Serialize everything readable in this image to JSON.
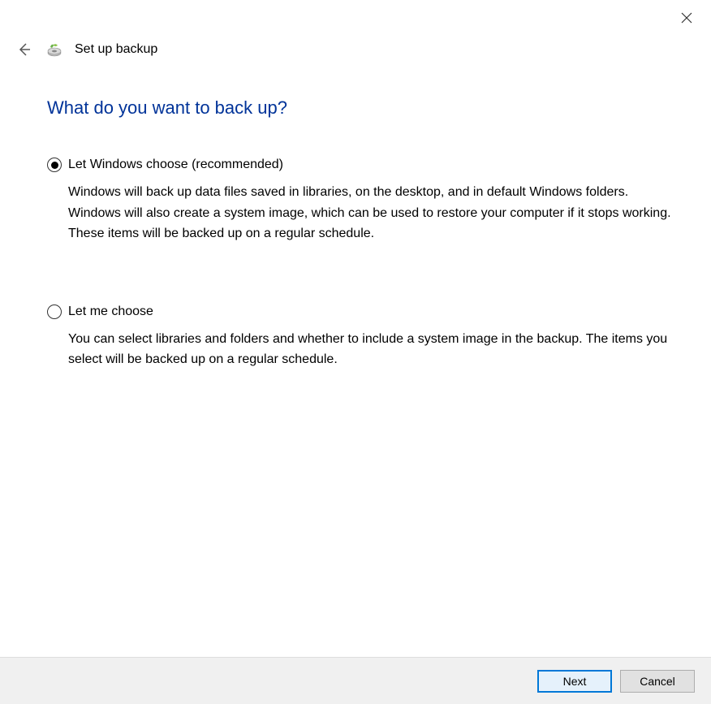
{
  "header": {
    "wizard_title": "Set up backup"
  },
  "main": {
    "question": "What do you want to back up?",
    "options": [
      {
        "label": "Let Windows choose (recommended)",
        "description": "Windows will back up data files saved in libraries, on the desktop, and in default Windows folders. Windows will also create a system image, which can be used to restore your computer if it stops working. These items will be backed up on a regular schedule.",
        "selected": true
      },
      {
        "label": "Let me choose",
        "description": "You can select libraries and folders and whether to include a system image in the backup. The items you select will be backed up on a regular schedule.",
        "selected": false
      }
    ]
  },
  "footer": {
    "next_label": "Next",
    "cancel_label": "Cancel"
  }
}
